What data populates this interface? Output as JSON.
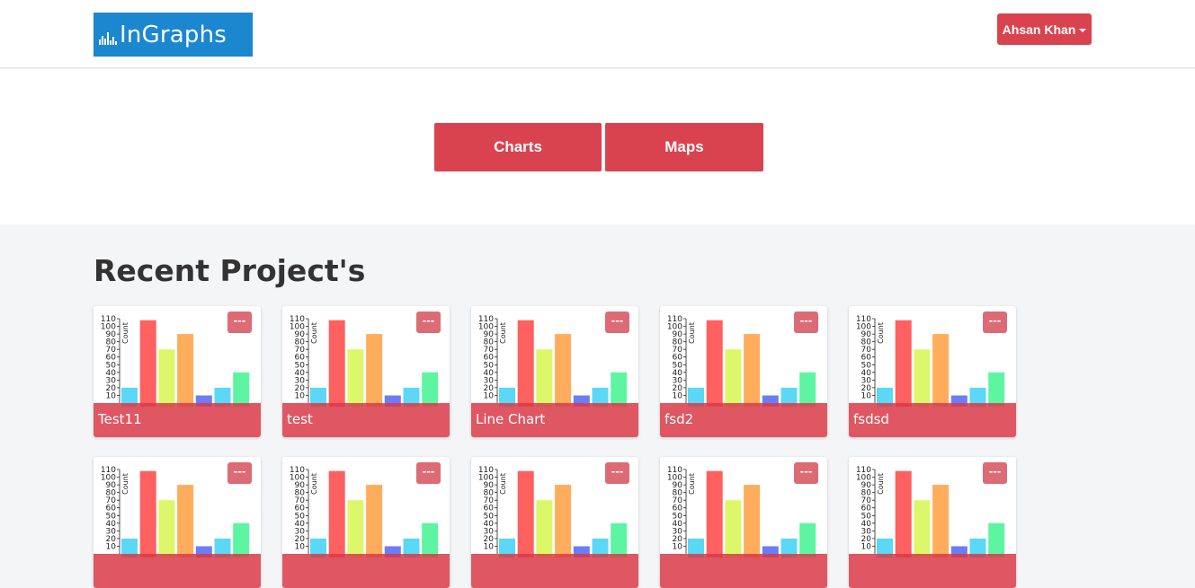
{
  "brand": {
    "logo_text": "InGraphs",
    "logo_icon": "bar-chart-icon",
    "color": "#1a87cf"
  },
  "header": {
    "user_label": "Ahsan Khan",
    "accent": "#d9434f"
  },
  "hero": {
    "charts_label": "Charts",
    "maps_label": "Maps"
  },
  "section": {
    "title": "Recent Project's"
  },
  "project_menu_label": "---",
  "projects": [
    {
      "name": "Test11"
    },
    {
      "name": "test"
    },
    {
      "name": "Line Chart"
    },
    {
      "name": "fsd2"
    },
    {
      "name": "fsdsd"
    },
    {
      "name": ""
    },
    {
      "name": ""
    },
    {
      "name": ""
    },
    {
      "name": ""
    },
    {
      "name": ""
    }
  ],
  "chart_data": {
    "type": "bar",
    "ylabel": "Count",
    "ylim": [
      0,
      110
    ],
    "y_ticks": [
      "110",
      "100",
      "90",
      "80",
      "70",
      "60",
      "50",
      "40",
      "30",
      "20",
      "10"
    ],
    "values": [
      20,
      108,
      70,
      90,
      10,
      20,
      40
    ],
    "colors": [
      "#5ad8f5",
      "#ff6060",
      "#ddf76a",
      "#ffad5c",
      "#6b7cf7",
      "#5ad8f5",
      "#5df5a2"
    ]
  }
}
